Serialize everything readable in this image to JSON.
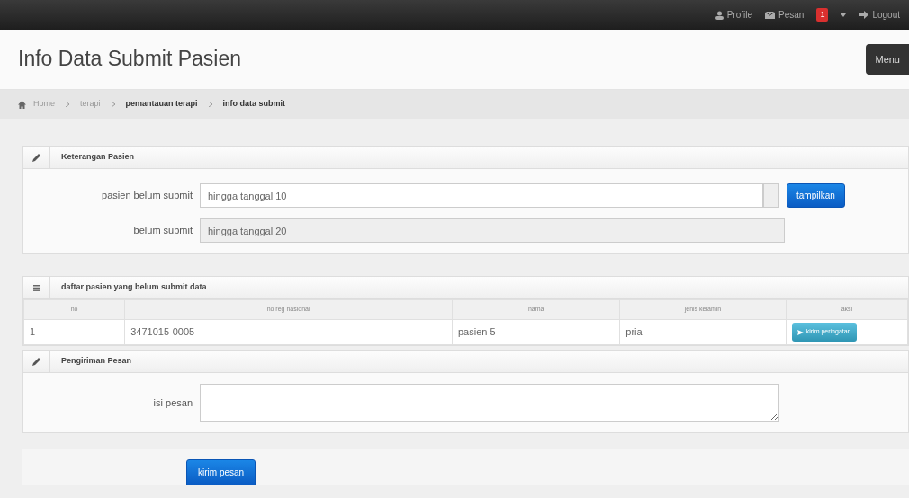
{
  "navbar": {
    "items": [
      {
        "kind": "profile",
        "label": "Profile"
      },
      {
        "kind": "messages",
        "label": "Pesan",
        "badge": "1"
      },
      {
        "kind": "logout",
        "label": "Logout"
      }
    ]
  },
  "page_header": {
    "title": "Info Data Submit Pasien",
    "menu_button": "Menu"
  },
  "breadcrumb": [
    {
      "label": "Home",
      "current": false
    },
    {
      "label": "terapi",
      "current": false
    },
    {
      "label": "pemantauan terapi",
      "current": true
    },
    {
      "label": "info data submit",
      "current": true
    }
  ],
  "keterangan_panel": {
    "title": "Keterangan Pasien",
    "fields": [
      {
        "label": "pasien belum submit",
        "value": "hingga tanggal 10",
        "disabled": false,
        "button": "tampilkan"
      },
      {
        "label": "belum submit",
        "value": "hingga tanggal 20",
        "disabled": true
      }
    ]
  },
  "table_panel": {
    "title": "daftar pasien yang belum submit data",
    "columns": [
      "no",
      "no reg nasional",
      "nama",
      "jenis kelamin",
      "aksi"
    ],
    "rows": [
      {
        "no": "1",
        "no_reg": "3471015-0005",
        "nama": "pasien 5",
        "jenis_kelamin": "pria",
        "action": "kirim peringatan"
      }
    ]
  },
  "pesan_panel": {
    "title": "Pengiriman Pesan",
    "label": "isi pesan"
  },
  "submit_button": "kirim pesan"
}
